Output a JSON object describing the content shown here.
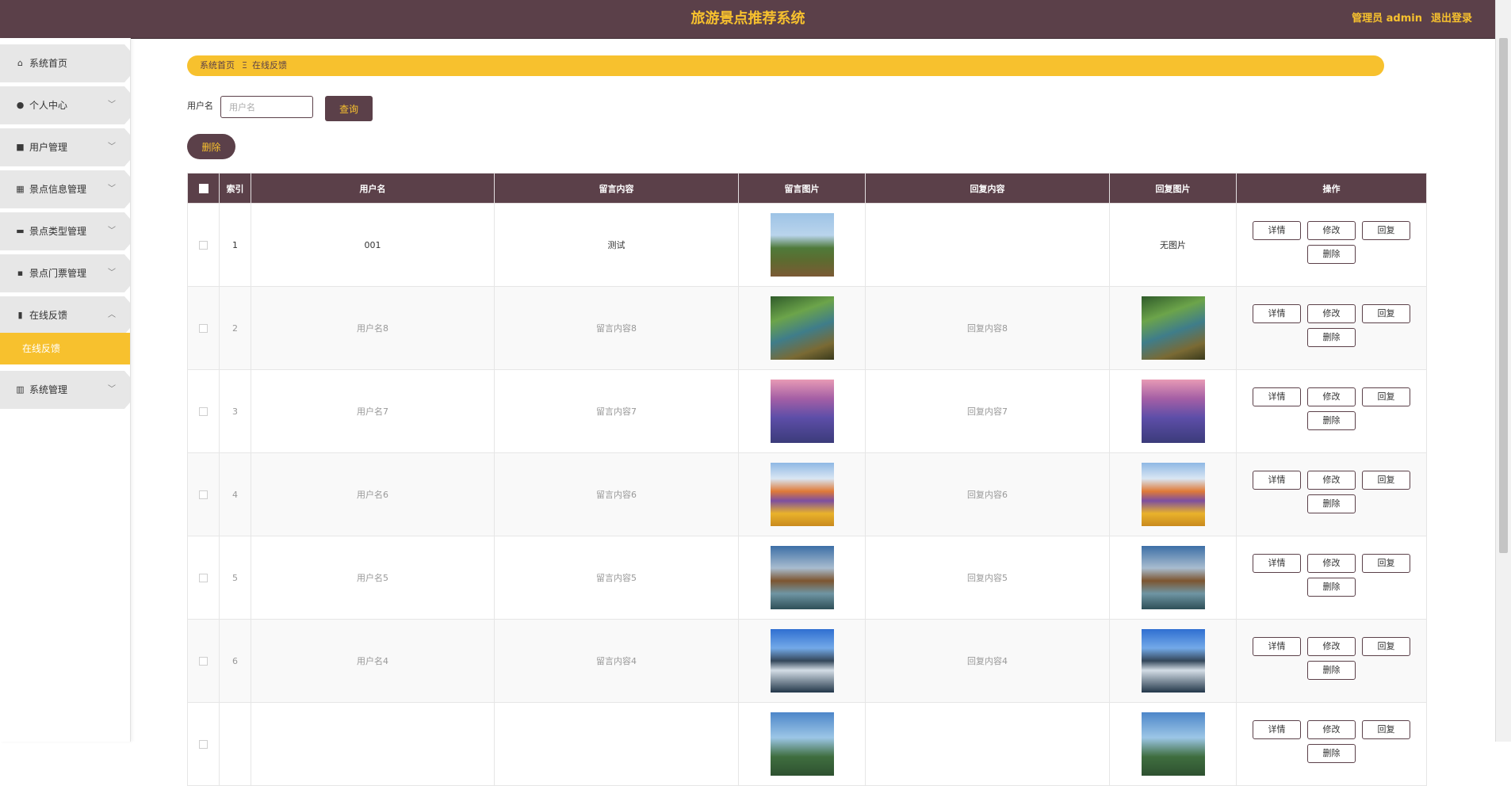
{
  "header": {
    "title": "旅游景点推荐系统",
    "admin_label": "管理员 admin",
    "logout_label": "退出登录"
  },
  "sidebar": {
    "items": [
      {
        "label": "系统首页",
        "icon": "home-icon",
        "glyph": "⌂",
        "expandable": false
      },
      {
        "label": "个人中心",
        "icon": "user-icon",
        "glyph": "●",
        "expandable": true
      },
      {
        "label": "用户管理",
        "icon": "user-manage-icon",
        "glyph": "■",
        "expandable": true
      },
      {
        "label": "景点信息管理",
        "icon": "grid-icon",
        "glyph": "▦",
        "expandable": true
      },
      {
        "label": "景点类型管理",
        "icon": "briefcase-icon",
        "glyph": "▬",
        "expandable": true
      },
      {
        "label": "景点门票管理",
        "icon": "ticket-icon",
        "glyph": "▪",
        "expandable": true
      },
      {
        "label": "在线反馈",
        "icon": "clipboard-icon",
        "glyph": "▮",
        "expandable": true,
        "open": true
      },
      {
        "label": "系统管理",
        "icon": "bar-chart-icon",
        "glyph": "▥",
        "expandable": true
      }
    ],
    "active_sub": "在线反馈",
    "chevron_down": "﹀",
    "chevron_up": "︿"
  },
  "breadcrumb": {
    "home": "系统首页",
    "separator": "Ξ",
    "current": "在线反馈"
  },
  "search": {
    "label": "用户名",
    "placeholder": "用户名",
    "query_button": "查询"
  },
  "toolbar": {
    "delete_button": "删除"
  },
  "table": {
    "headers": {
      "index": "索引",
      "username": "用户名",
      "message": "留言内容",
      "message_image": "留言图片",
      "reply": "回复内容",
      "reply_image": "回复图片",
      "actions": "操作"
    },
    "rows": [
      {
        "index": "1",
        "username": "001",
        "message": "测试",
        "reply": "",
        "reply_image_text": "无图片"
      },
      {
        "index": "2",
        "username": "用户名8",
        "message": "留言内容8",
        "reply": "回复内容8",
        "reply_image_text": ""
      },
      {
        "index": "3",
        "username": "用户名7",
        "message": "留言内容7",
        "reply": "回复内容7",
        "reply_image_text": ""
      },
      {
        "index": "4",
        "username": "用户名6",
        "message": "留言内容6",
        "reply": "回复内容6",
        "reply_image_text": ""
      },
      {
        "index": "5",
        "username": "用户名5",
        "message": "留言内容5",
        "reply": "回复内容5",
        "reply_image_text": ""
      },
      {
        "index": "6",
        "username": "用户名4",
        "message": "留言内容4",
        "reply": "回复内容4",
        "reply_image_text": ""
      },
      {
        "index": "",
        "username": "",
        "message": "",
        "reply": "",
        "reply_image_text": ""
      }
    ],
    "action_labels": {
      "detail": "详情",
      "edit": "修改",
      "reply": "回复",
      "delete": "删除"
    }
  },
  "colors": {
    "primary": "#5b4049",
    "accent": "#f7c12e"
  }
}
